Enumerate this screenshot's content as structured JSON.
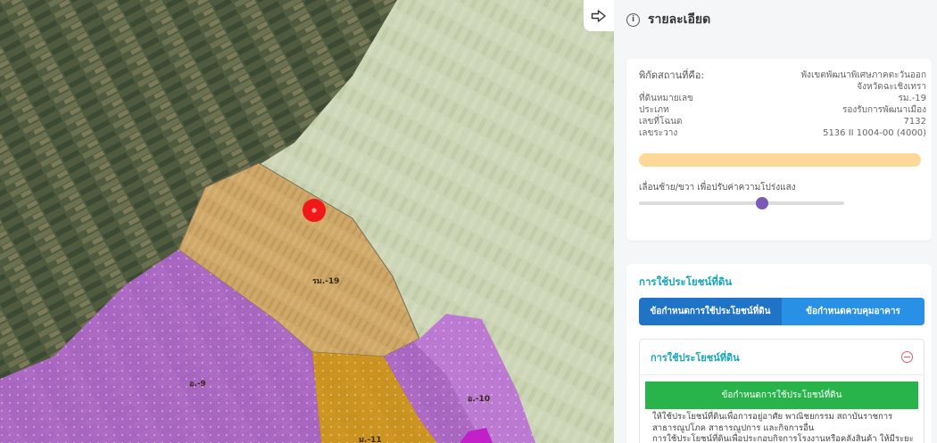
{
  "panel": {
    "header_title": "รายละเอียด",
    "info_icon": "info-circle-icon",
    "collapse_icon": "arrow-right-icon"
  },
  "details": {
    "location_label": "พิกัดสถานที่คือ:",
    "location_value": "พังเขตพัฒนาพิเศษภาคตะวันออก จังหวัดฉะเชิงเทรา",
    "parcel_label": "ที่ดินหมายเลข",
    "parcel_value": "รม.-19",
    "type_label": "ประเภท",
    "type_value": "รองรับการพัฒนาเมือง",
    "deed_label": "เลขที่โฉนด",
    "deed_value": "7132",
    "sheet_label": "เลขระวาง",
    "sheet_value": "5136 II 1004-00 (4000)",
    "zone_color": "#fcd998"
  },
  "opacity": {
    "label": "เลื่อนซ้าย/ขวา เพื่อปรับค่าความโปร่งแสง",
    "value_fraction": 0.6
  },
  "landuse": {
    "section_title": "การใช้ประโยชน์ที่ดิน",
    "tab_active": "ข้อกำหนดการใช้ประโยชน์ที่ดิน",
    "tab_inactive": "ข้อกำหนดควบคุมอาคาร",
    "accordion_title": "การใช้ประโยชน์ที่ดิน",
    "table_header": "ข้อกำหนดการใช้ประโยชน์ที่ดิน",
    "body_line1": "ให้ใช้ประโยชน์ที่ดินเพื่อการอยู่อาศัย พาณิชยกรรม สถาบันราชการ",
    "body_line2": "สาธารณูปโภค สาธารณูปการ และกิจการอื่น",
    "body_line3": "การใช้ประโยชน์ที่ดินเพื่อประกอบกิจการโรงงานหรือคลังสินค้า ให้มีระยะ"
  },
  "map": {
    "zone_labels": [
      "รม.-19",
      "อ.-9",
      "อ.-10",
      "ม.-11"
    ],
    "marker_color": "#f01818"
  }
}
